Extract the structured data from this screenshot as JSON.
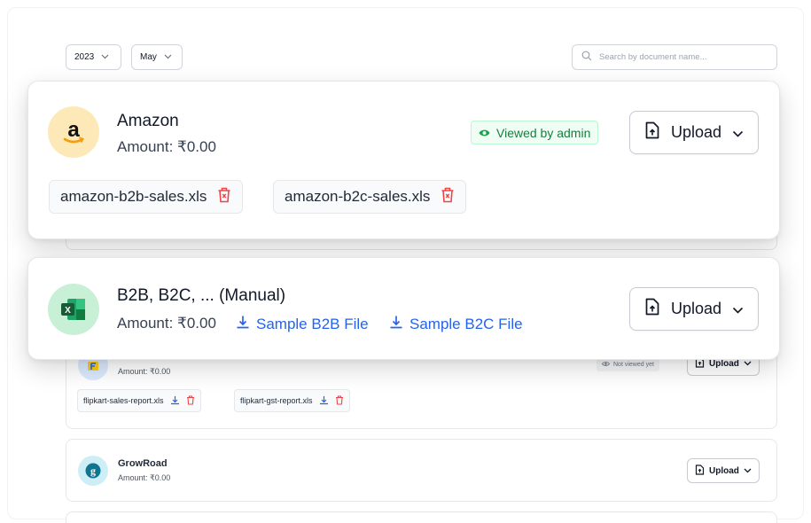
{
  "filters": {
    "year": "2023",
    "month": "May",
    "search_placeholder": "Search by document name..."
  },
  "amazon": {
    "name": "Amazon",
    "amount": "Amount: ₹0.00",
    "status": "Viewed by admin",
    "upload_label": "Upload",
    "files": [
      "amazon-b2b-sales.xls",
      "amazon-b2c-sales.xls"
    ]
  },
  "manual": {
    "name": "B2B, B2C, ... (Manual)",
    "amount": "Amount: ₹0.00",
    "sample_b2b": "Sample B2B File",
    "sample_b2c": "Sample B2C File",
    "upload_label": "Upload"
  },
  "flipkart": {
    "amount": "Amount: ₹0.00",
    "status": "Not viewed yet",
    "upload_label": "Upload",
    "files": [
      "flipkart-sales-report.xls",
      "flipkart-gst-report.xls"
    ]
  },
  "growroad": {
    "name": "GrowRoad",
    "amount": "Amount: ₹0.00",
    "upload_label": "Upload"
  },
  "colors": {
    "amazon_bg": "#fde9b8",
    "excel_bg": "#c8f0d6",
    "flipkart_bg": "#dbeafe",
    "growroad_bg": "#cdeef7",
    "link_blue": "#2563eb",
    "delete_red": "#ef4444",
    "viewed_green": "#16a34a"
  }
}
